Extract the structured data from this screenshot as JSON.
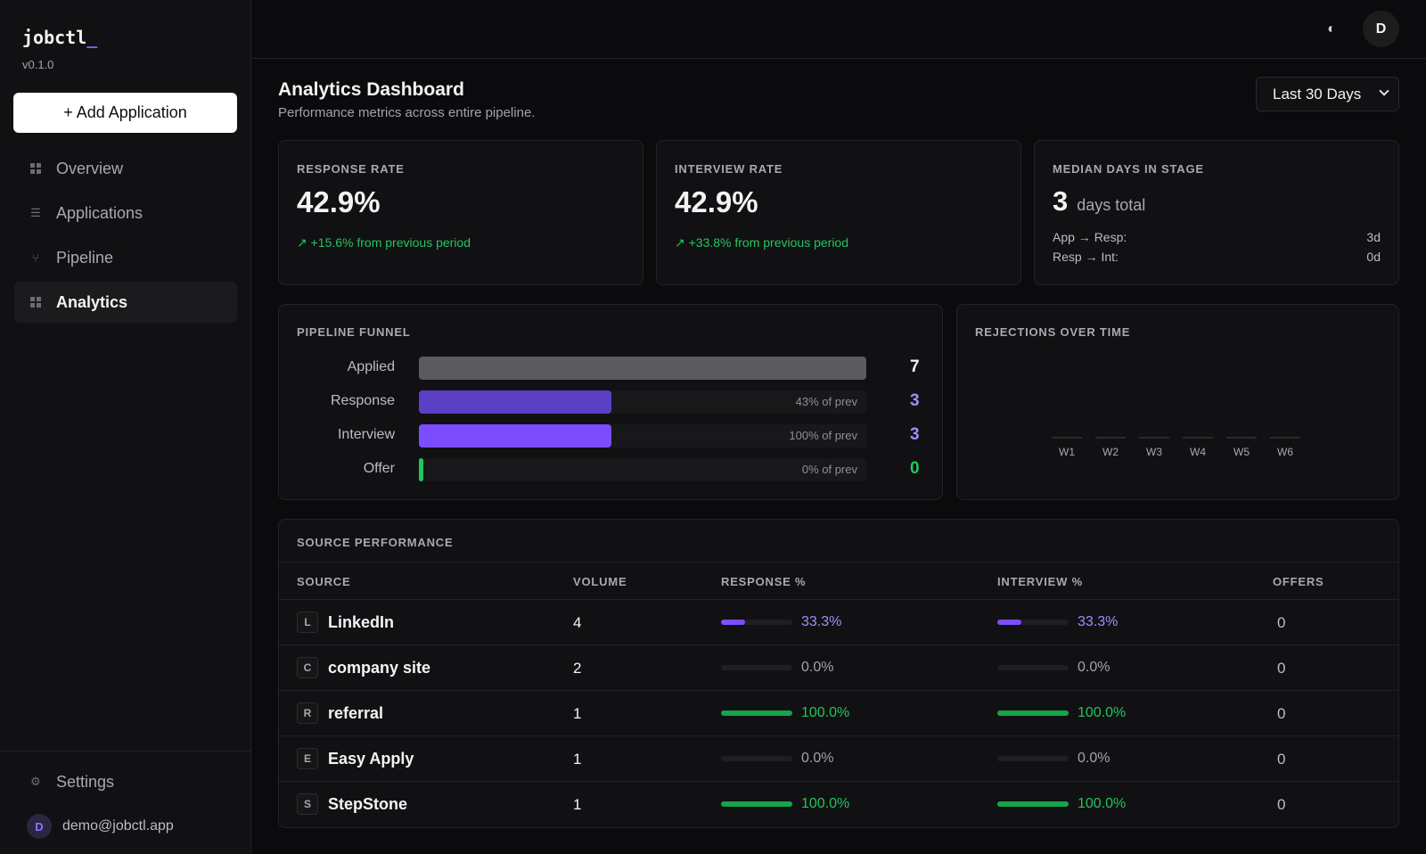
{
  "app": {
    "name": "jobctl",
    "cursor": "_",
    "version": "v0.1.0"
  },
  "sidebar": {
    "add_button": "+ Add Application",
    "items": [
      {
        "label": "Overview",
        "icon": "grid-icon",
        "active": false
      },
      {
        "label": "Applications",
        "icon": "list-icon",
        "active": false
      },
      {
        "label": "Pipeline",
        "icon": "pipeline-icon",
        "active": false
      },
      {
        "label": "Analytics",
        "icon": "bar-chart-icon",
        "active": true
      }
    ],
    "settings_label": "Settings",
    "user_initial": "D",
    "user_email": "demo@jobctl.app"
  },
  "header": {
    "avatar_initial": "D",
    "theme_icon": "contrast-icon"
  },
  "page": {
    "title": "Analytics Dashboard",
    "subtitle": "Performance metrics across entire pipeline.",
    "period": "Last 30 Days"
  },
  "metrics": {
    "response_rate": {
      "label": "Response Rate",
      "value": "42.9%",
      "delta": "↗ +15.6% from previous period"
    },
    "interview_rate": {
      "label": "Interview Rate",
      "value": "42.9%",
      "delta": "↗ +33.8% from previous period"
    },
    "median_days": {
      "label": "Median Days in Stage",
      "value": "3",
      "unit": "days total",
      "rows": [
        {
          "label": "App → Resp:",
          "value": "3d"
        },
        {
          "label": "Resp → Int:",
          "value": "0d"
        }
      ]
    }
  },
  "funnel": {
    "label": "Pipeline Funnel",
    "stages": [
      {
        "label": "Applied",
        "count": "7",
        "prev": "",
        "fraction": 1.0,
        "color": "#5a5a5f",
        "count_color": "#f3f3f5"
      },
      {
        "label": "Response",
        "count": "3",
        "prev": "43% of prev",
        "fraction": 0.43,
        "color": "#5b3fc4",
        "count_color": "#a78bfa"
      },
      {
        "label": "Interview",
        "count": "3",
        "prev": "100% of prev",
        "fraction": 0.43,
        "color": "#7c4dff",
        "count_color": "#a78bfa"
      },
      {
        "label": "Offer",
        "count": "0",
        "prev": "0% of prev",
        "fraction": 0.0,
        "color": "#22c55e",
        "count_color": "#22c55e"
      }
    ]
  },
  "rejections": {
    "label": "Rejections Over Time",
    "weeks": [
      "W1",
      "W2",
      "W3",
      "W4",
      "W5",
      "W6"
    ]
  },
  "sources": {
    "label": "Source Performance",
    "columns": [
      "Source",
      "Volume",
      "Response %",
      "Interview %",
      "Offers"
    ],
    "rows": [
      {
        "badge": "L",
        "name": "LinkedIn",
        "volume": "4",
        "response": "33.3%",
        "response_frac": 0.333,
        "interview": "33.3%",
        "interview_frac": 0.333,
        "offers": "0",
        "color": "#7c4dff",
        "text_color": "#a78bfa"
      },
      {
        "badge": "C",
        "name": "company site",
        "volume": "2",
        "response": "0.0%",
        "response_frac": 0,
        "interview": "0.0%",
        "interview_frac": 0,
        "offers": "0",
        "color": "#7c4dff",
        "text_color": "#a3a3a8"
      },
      {
        "badge": "R",
        "name": "referral",
        "volume": "1",
        "response": "100.0%",
        "response_frac": 1,
        "interview": "100.0%",
        "interview_frac": 1,
        "offers": "0",
        "color": "#16a34a",
        "text_color": "#22c55e"
      },
      {
        "badge": "E",
        "name": "Easy Apply",
        "volume": "1",
        "response": "0.0%",
        "response_frac": 0,
        "interview": "0.0%",
        "interview_frac": 0,
        "offers": "0",
        "color": "#7c4dff",
        "text_color": "#a3a3a8"
      },
      {
        "badge": "S",
        "name": "StepStone",
        "volume": "1",
        "response": "100.0%",
        "response_frac": 1,
        "interview": "100.0%",
        "interview_frac": 1,
        "offers": "0",
        "color": "#16a34a",
        "text_color": "#22c55e"
      }
    ]
  }
}
